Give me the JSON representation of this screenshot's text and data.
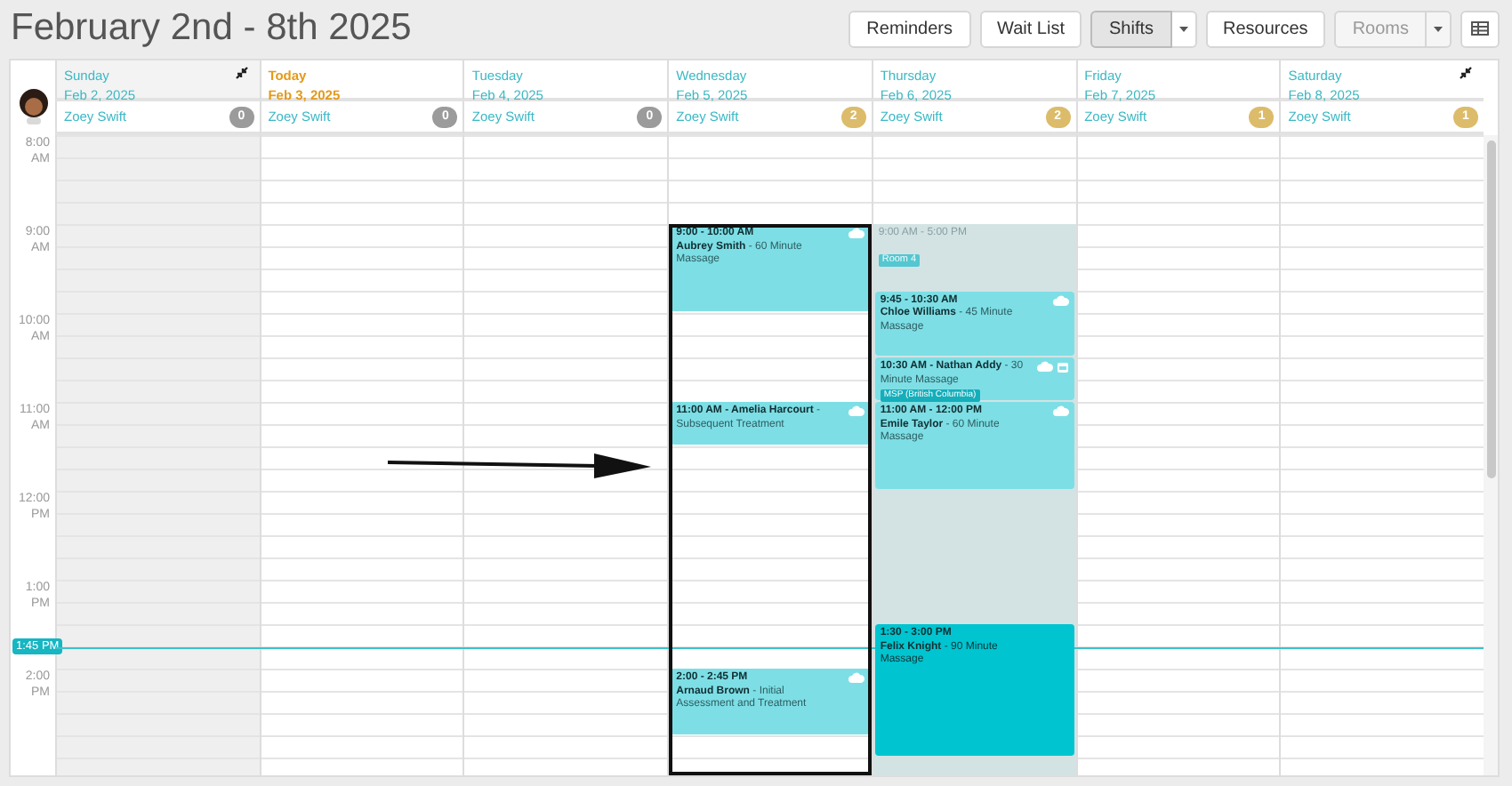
{
  "title": "February 2nd - 8th 2025",
  "toolbar": [
    {
      "label": "Reminders",
      "selected": false,
      "disabled": false,
      "dropdown": false
    },
    {
      "label": "Wait List",
      "selected": false,
      "disabled": false,
      "dropdown": false
    },
    {
      "label": "Shifts",
      "selected": true,
      "disabled": false,
      "dropdown": true
    },
    {
      "label": "Resources",
      "selected": false,
      "disabled": false,
      "dropdown": false
    },
    {
      "label": "Rooms",
      "selected": false,
      "disabled": true,
      "dropdown": true
    }
  ],
  "hours": [
    {
      "time": "8:00",
      "period": "AM"
    },
    {
      "time": "9:00",
      "period": "AM"
    },
    {
      "time": "10:00",
      "period": "AM"
    },
    {
      "time": "11:00",
      "period": "AM"
    },
    {
      "time": "12:00",
      "period": "PM"
    },
    {
      "time": "1:00",
      "period": "PM"
    },
    {
      "time": "2:00",
      "period": "PM"
    }
  ],
  "now": {
    "label": "1:45 PM"
  },
  "days": [
    {
      "name": "Sunday",
      "date": "Feb 2, 2025",
      "today": false,
      "past": true,
      "highlighted": false,
      "staff": "Zoey Swift",
      "badge": {
        "count": "0",
        "color": "#9b9b9b"
      }
    },
    {
      "name": "Today",
      "date": "Feb 3, 2025",
      "today": true,
      "past": false,
      "highlighted": false,
      "staff": "Zoey Swift",
      "badge": {
        "count": "0",
        "color": "#9b9b9b"
      }
    },
    {
      "name": "Tuesday",
      "date": "Feb 4, 2025",
      "today": false,
      "past": false,
      "highlighted": false,
      "staff": "Zoey Swift",
      "badge": {
        "count": "0",
        "color": "#9b9b9b"
      }
    },
    {
      "name": "Wednesday",
      "date": "Feb 5, 2025",
      "today": false,
      "past": false,
      "highlighted": true,
      "staff": "Zoey Swift",
      "badge": {
        "count": "2",
        "color": "#dcbc6a"
      },
      "events": [
        {
          "kind": "appointment",
          "time": "9:00 - 10:00 AM",
          "client": "Aubrey Smith",
          "service": " - 60 Minute Massage",
          "color": "#7ddfe5",
          "synced": true,
          "insured": false
        },
        {
          "kind": "appointment",
          "time": "11:00 AM - Amelia Harcourt",
          "service": " - Subsequent Treatment",
          "color": "#7ddfe5",
          "synced": true,
          "insured": false
        },
        {
          "kind": "appointment",
          "time": "2:00 - 2:45 PM",
          "client": "Arnaud Brown",
          "service": " - Initial Assessment and Treatment",
          "color": "#7ddfe5",
          "synced": true,
          "insured": false
        }
      ]
    },
    {
      "name": "Thursday",
      "date": "Feb 6, 2025",
      "today": false,
      "past": false,
      "highlighted": false,
      "staff": "Zoey Swift",
      "badge": {
        "count": "2",
        "color": "#dcbc6a"
      },
      "events": [
        {
          "kind": "shift",
          "time": "9:00 AM - 5:00 PM",
          "tag": "Room 4"
        },
        {
          "kind": "appointment",
          "time": "9:45 - 10:30 AM",
          "client": "Chloe Williams",
          "service": " - 45 Minute Massage",
          "color": "#7ddfe5",
          "synced": true,
          "insured": false
        },
        {
          "kind": "appointment",
          "time": "10:30 AM - Nathan Addy",
          "service": " - 30 Minute Massage",
          "tag": "MSP (British Columbia)",
          "color": "#7ddfe5",
          "synced": true,
          "insured": true
        },
        {
          "kind": "appointment",
          "time": "11:00 AM - 12:00 PM",
          "client": "Emile Taylor",
          "service": " - 60 Minute Massage",
          "color": "#7ddfe5",
          "synced": true,
          "insured": false
        },
        {
          "kind": "appointment",
          "time": "1:30 - 3:00 PM",
          "client": "Felix Knight",
          "service": " - 90 Minute Massage",
          "color": "#00c5d0",
          "synced": false,
          "insured": false
        }
      ]
    },
    {
      "name": "Friday",
      "date": "Feb 7, 2025",
      "today": false,
      "past": false,
      "highlighted": false,
      "staff": "Zoey Swift",
      "badge": {
        "count": "1",
        "color": "#dcbc6a"
      }
    },
    {
      "name": "Saturday",
      "date": "Feb 8, 2025",
      "today": false,
      "past": false,
      "highlighted": false,
      "staff": "Zoey Swift",
      "badge": {
        "count": "1",
        "color": "#dcbc6a"
      }
    }
  ]
}
